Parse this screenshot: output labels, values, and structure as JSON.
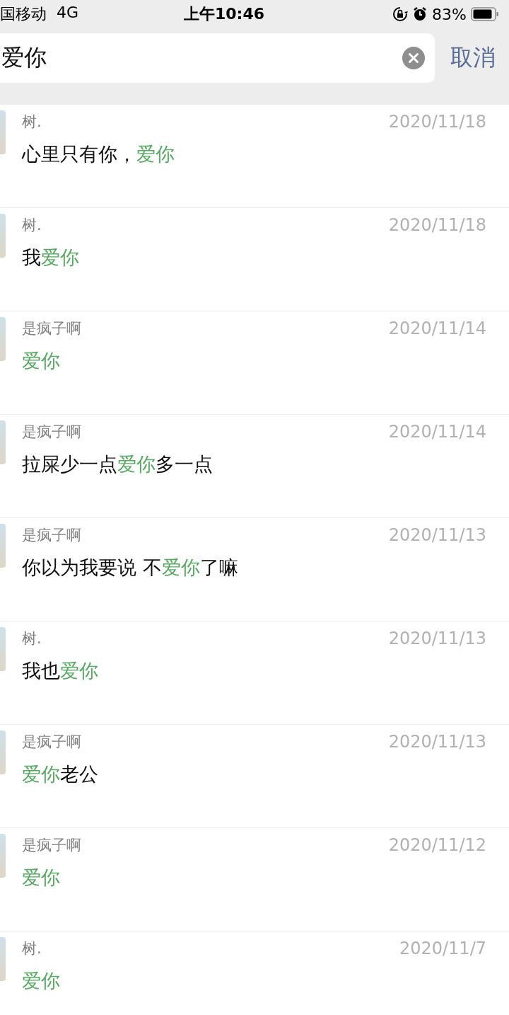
{
  "status_bar": {
    "carrier": "国移动",
    "network": "4G",
    "time": "上午10:46",
    "battery": "83%"
  },
  "search": {
    "value": "爱你",
    "cancel": "取消"
  },
  "results": [
    {
      "name": "树.",
      "date": "2020/11/18",
      "message": [
        {
          "text": "心里只有你，",
          "highlight": false
        },
        {
          "text": "爱你",
          "highlight": true
        }
      ]
    },
    {
      "name": "树.",
      "date": "2020/11/18",
      "message": [
        {
          "text": "我",
          "highlight": false
        },
        {
          "text": "爱你",
          "highlight": true
        }
      ]
    },
    {
      "name": "是疯子啊",
      "date": "2020/11/14",
      "message": [
        {
          "text": "爱你",
          "highlight": true
        }
      ]
    },
    {
      "name": "是疯子啊",
      "date": "2020/11/14",
      "message": [
        {
          "text": "拉屎少一点",
          "highlight": false
        },
        {
          "text": "爱你",
          "highlight": true
        },
        {
          "text": "多一点",
          "highlight": false
        }
      ]
    },
    {
      "name": "是疯子啊",
      "date": "2020/11/13",
      "message": [
        {
          "text": "你以为我要说 不",
          "highlight": false
        },
        {
          "text": "爱你",
          "highlight": true
        },
        {
          "text": "了嘛",
          "highlight": false
        }
      ]
    },
    {
      "name": "树.",
      "date": "2020/11/13",
      "message": [
        {
          "text": "我也",
          "highlight": false
        },
        {
          "text": "爱你",
          "highlight": true
        }
      ]
    },
    {
      "name": "是疯子啊",
      "date": "2020/11/13",
      "message": [
        {
          "text": "爱你",
          "highlight": true
        },
        {
          "text": "老公",
          "highlight": false
        }
      ]
    },
    {
      "name": "是疯子啊",
      "date": "2020/11/12",
      "message": [
        {
          "text": "爱你",
          "highlight": true
        }
      ]
    },
    {
      "name": "树.",
      "date": "2020/11/7",
      "message": [
        {
          "text": "爱你",
          "highlight": true
        }
      ]
    }
  ]
}
